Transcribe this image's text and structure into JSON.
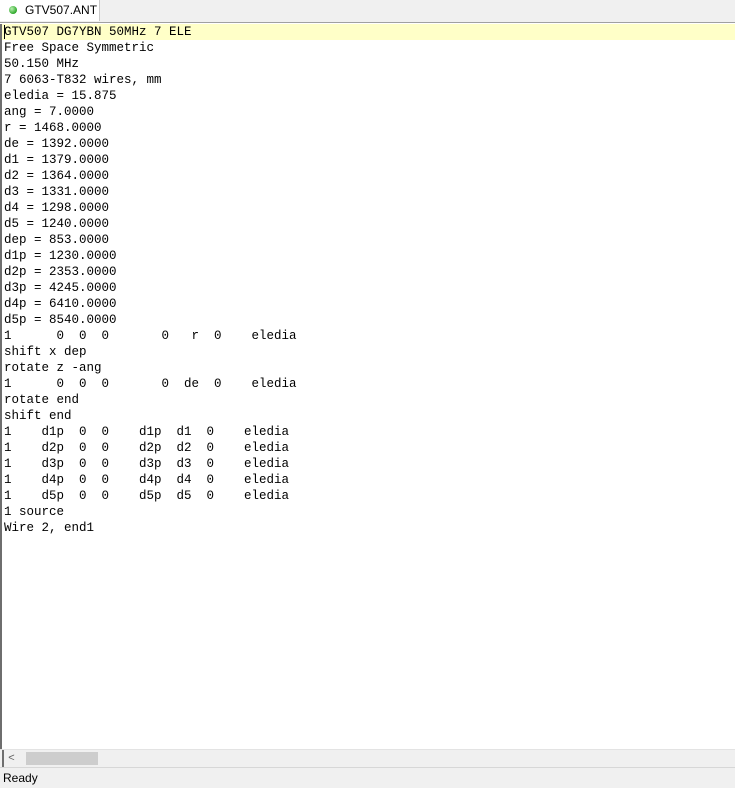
{
  "tab": {
    "label": "GTV507.ANT",
    "icon": "green-dot-icon"
  },
  "editor": {
    "lines": [
      "GTV507 DG7YBN 50MHz 7 ELE",
      "Free Space Symmetric",
      "50.150 MHz",
      "7 6063-T832 wires, mm",
      "eledia = 15.875",
      "ang = 7.0000",
      "r = 1468.0000",
      "de = 1392.0000",
      "d1 = 1379.0000",
      "d2 = 1364.0000",
      "d3 = 1331.0000",
      "d4 = 1298.0000",
      "d5 = 1240.0000",
      "dep = 853.0000",
      "d1p = 1230.0000",
      "d2p = 2353.0000",
      "d3p = 4245.0000",
      "d4p = 6410.0000",
      "d5p = 8540.0000",
      "1      0  0  0       0   r  0    eledia",
      "shift x dep",
      "rotate z -ang",
      "1      0  0  0       0  de  0    eledia",
      "rotate end",
      "shift end",
      "1    d1p  0  0    d1p  d1  0    eledia",
      "1    d2p  0  0    d2p  d2  0    eledia",
      "1    d3p  0  0    d3p  d3  0    eledia",
      "1    d4p  0  0    d4p  d4  0    eledia",
      "1    d5p  0  0    d5p  d5  0    eledia",
      "1 source",
      "Wire 2, end1"
    ]
  },
  "scrollbar": {
    "left_arrow": "<"
  },
  "status": {
    "text": "Ready"
  },
  "colors": {
    "current_line_highlight": "#ffffc8",
    "tab_icon": "#2ea82a"
  }
}
